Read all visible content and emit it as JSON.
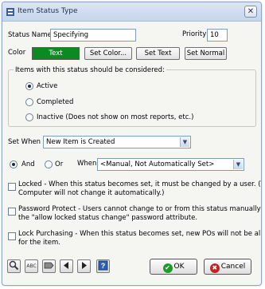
{
  "window": {
    "title": "Item Status Type",
    "close_glyph": "✕"
  },
  "form": {
    "status_name_label": "Status Name",
    "status_name_value": "Specifying",
    "priority_label": "Priority",
    "priority_value": "10",
    "color_label": "Color",
    "color_swatch_text": "Text",
    "color_swatch_bg": "#0b8a22",
    "set_color_label": "Set Color...",
    "set_text_label": "Set Text",
    "set_normal_label": "Set Normal"
  },
  "consider_group": {
    "legend": "Items with this status should be considered:",
    "options": [
      {
        "label": "Active",
        "selected": true
      },
      {
        "label": "Completed",
        "selected": false
      },
      {
        "label": "Inactive (Does not show on most reports, etc.)",
        "selected": false
      }
    ]
  },
  "set_when": {
    "label": "Set When",
    "value": "New Item is Created",
    "and_label": "And",
    "or_label": "Or",
    "when_label": "When",
    "when_value": "<Manual, Not Automatically Set>"
  },
  "checks": [
    {
      "line1": "Locked - When this status becomes set, it must be changed by a user.  (The",
      "line2": "Computer will not change it automatically.)",
      "checked": false
    },
    {
      "line1": "Password Protect - Users cannot change to or from this status manually without",
      "line2": "the \"allow locked status change\" password attribute.",
      "checked": false
    },
    {
      "line1": "Lock Purchasing - When this status becomes set, new POs will not be allowed",
      "line2": "for the item.",
      "checked": false
    }
  ],
  "footer": {
    "tools": [
      "magnifier-icon",
      "abc-spellcheck-icon",
      "tag-icon",
      "prev-arrow-icon",
      "next-arrow-icon",
      "help-icon"
    ],
    "ok_label": "OK",
    "cancel_label": "Cancel"
  }
}
